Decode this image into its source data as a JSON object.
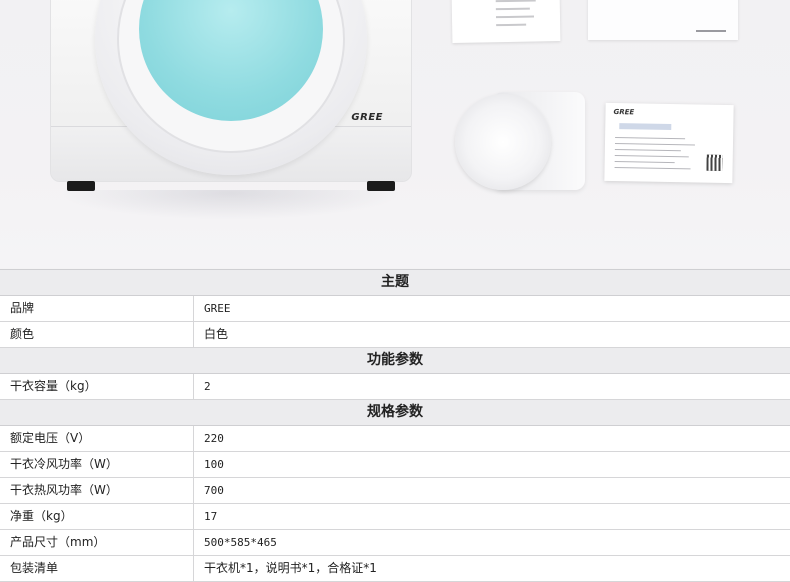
{
  "hero": {
    "brand_logo": "GREE",
    "card_brand": "GREE"
  },
  "spec_table": {
    "sections": [
      {
        "title": "主题",
        "rows": [
          {
            "key": "品牌",
            "value": "GREE"
          },
          {
            "key": "颜色",
            "value": "白色"
          }
        ]
      },
      {
        "title": "功能参数",
        "rows": [
          {
            "key": "干衣容量（kg）",
            "value": "2"
          }
        ]
      },
      {
        "title": "规格参数",
        "rows": [
          {
            "key": "额定电压（V）",
            "value": "220"
          },
          {
            "key": "干衣冷风功率（W）",
            "value": "100"
          },
          {
            "key": "干衣热风功率（W）",
            "value": "700"
          },
          {
            "key": "净重（kg）",
            "value": "17"
          },
          {
            "key": "产品尺寸（mm）",
            "value": "500*585*465"
          },
          {
            "key": "包装清单",
            "value": "干衣机*1，说明书*1，合格证*1"
          }
        ]
      }
    ]
  }
}
